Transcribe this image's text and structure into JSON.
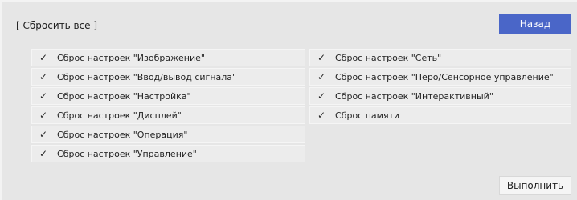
{
  "title": "[ Сбросить все ]",
  "back_label": "Назад",
  "execute_label": "Выполнить",
  "accent_color": "#4a66c8",
  "check_icon": "✓",
  "left_items": [
    {
      "label": "Сброс настроек \"Изображение\""
    },
    {
      "label": "Сброс настроек \"Ввод/вывод сигнала\""
    },
    {
      "label": "Сброс настроек \"Настройка\""
    },
    {
      "label": "Сброс настроек \"Дисплей\""
    },
    {
      "label": "Сброс настроек \"Операция\""
    },
    {
      "label": "Сброс настроек \"Управление\""
    }
  ],
  "right_items": [
    {
      "label": "Сброс настроек \"Сеть\""
    },
    {
      "label": "Сброс настроек \"Перо/Сенсорное управление\""
    },
    {
      "label": "Сброс настроек \"Интерактивный\""
    },
    {
      "label": "Сброс памяти"
    }
  ]
}
